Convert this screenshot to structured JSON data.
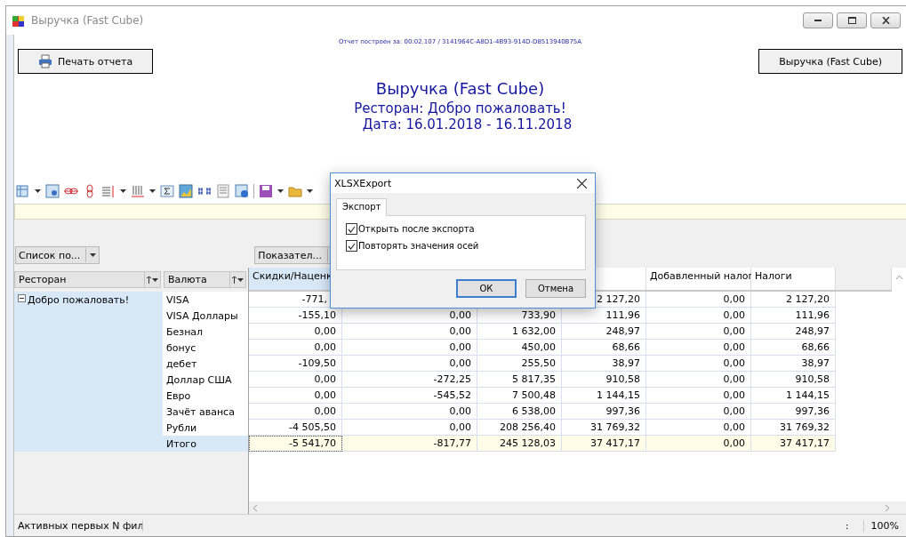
{
  "window": {
    "title": "Выручка (Fast Cube)"
  },
  "report": {
    "build_info": "Отчет построен за: 00:02.107 / 3141964C-A8D1-4B93-914D-D8513940B75A",
    "print_button": "Печать отчета",
    "report_button": "Выручка (Fast Cube)",
    "title": "Выручка (Fast Cube)",
    "subtitle": "Ресторан: Добро пожаловать!",
    "dates": "Дата: 16.01.2018 - 16.11.2018"
  },
  "pivot": {
    "filter_field": "Список по...",
    "measures_field": "Показател...",
    "row_headers": [
      "Ресторан",
      "Валюта"
    ],
    "columns": [
      "Скидки/Наценк",
      "Добавленный налог",
      "Налоги"
    ],
    "group": {
      "label": "Добро пожаловать!",
      "expanded": true
    },
    "rows": [
      {
        "label": "VISA",
        "kind": "item",
        "values": [
          "-771,",
          "2 127,20",
          "0,00",
          "2 127,20"
        ]
      },
      {
        "label": "VISA Доллары",
        "kind": "item",
        "values": [
          "-155,10",
          "0,00",
          "733,90",
          "111,96",
          "0,00",
          "111,96"
        ]
      },
      {
        "label": "Безнал",
        "kind": "item",
        "values": [
          "0,00",
          "0,00",
          "1 632,00",
          "248,97",
          "0,00",
          "248,97"
        ]
      },
      {
        "label": "бонус",
        "kind": "item",
        "values": [
          "0,00",
          "0,00",
          "450,00",
          "68,66",
          "0,00",
          "68,66"
        ]
      },
      {
        "label": "дебет",
        "kind": "item",
        "values": [
          "-109,50",
          "0,00",
          "255,50",
          "38,97",
          "0,00",
          "38,97"
        ]
      },
      {
        "label": "Доллар США",
        "kind": "item",
        "values": [
          "0,00",
          "-272,25",
          "5 817,35",
          "910,58",
          "0,00",
          "910,58"
        ]
      },
      {
        "label": "Евро",
        "kind": "item",
        "values": [
          "0,00",
          "-545,52",
          "7 500,48",
          "1 144,15",
          "0,00",
          "1 144,15"
        ]
      },
      {
        "label": "Зачёт аванса",
        "kind": "item",
        "values": [
          "0,00",
          "0,00",
          "6 538,00",
          "997,36",
          "0,00",
          "997,36"
        ]
      },
      {
        "label": "Рубли",
        "kind": "item",
        "values": [
          "-4 505,50",
          "0,00",
          "208 256,40",
          "31 769,32",
          "0,00",
          "31 769,32"
        ]
      },
      {
        "label": "Итого",
        "kind": "total",
        "values": [
          "-5 541,70",
          "-817,77",
          "245 128,03",
          "37 417,17",
          "0,00",
          "37 417,17"
        ]
      }
    ]
  },
  "status_bar": {
    "text": "Активных первых N фил",
    "separator": ":",
    "zoom": "100%"
  },
  "dialog": {
    "title": "XLSXExport",
    "tabs": [
      {
        "label": "Экспорт",
        "selected": true
      }
    ],
    "options": [
      {
        "label": "Открыть после экспорта",
        "checked": true
      },
      {
        "label": "Повторять значения осей",
        "checked": true
      }
    ],
    "buttons": [
      {
        "label": "ОК",
        "default": true
      },
      {
        "label": "Отмена",
        "default": false
      }
    ]
  }
}
